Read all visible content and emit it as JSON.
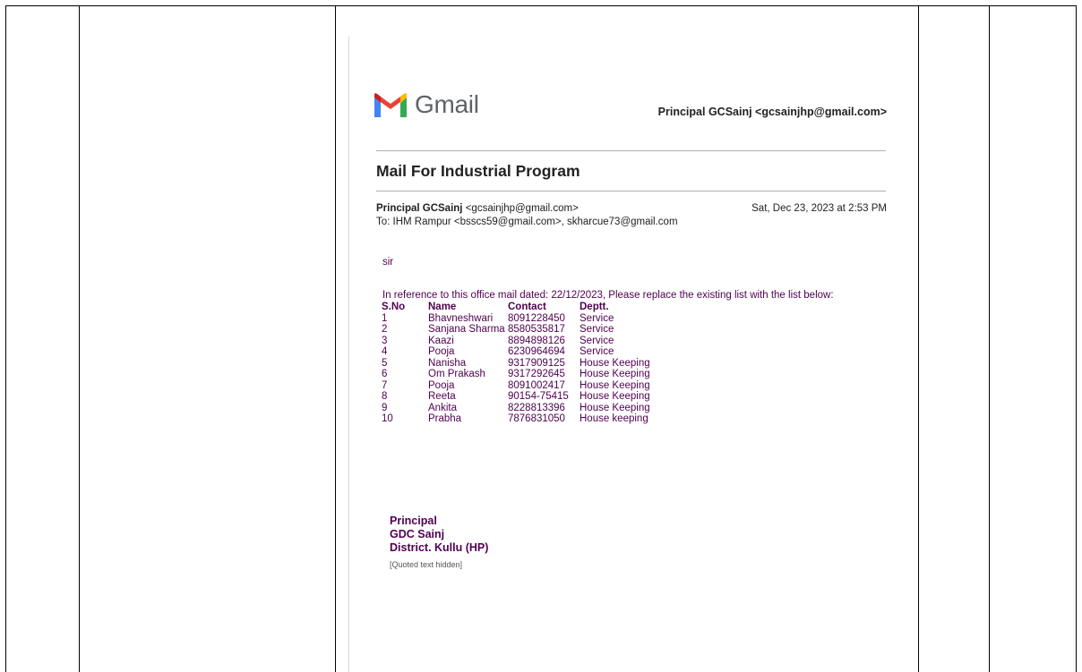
{
  "gmail": {
    "logo_text": "Gmail",
    "account": "Principal GCSainj <gcsainjhp@gmail.com>"
  },
  "email": {
    "subject": "Mail For Industrial Program",
    "sender_name": "Principal GCSainj",
    "sender_email": "<gcsainjhp@gmail.com>",
    "date": "Sat, Dec 23, 2023 at 2:53 PM",
    "to": "To: IHM Rampur <bsscs59@gmail.com>, skharcue73@gmail.com",
    "greeting": "sir",
    "reference": "In reference to this office mail dated: 22/12/2023, Please replace the existing list with the list below:",
    "table": {
      "headers": [
        "S.No",
        "Name",
        "Contact",
        "Deptt."
      ],
      "rows": [
        [
          "1",
          "Bhavneshwari",
          "8091228450",
          "Service"
        ],
        [
          "2",
          "Sanjana Sharma",
          "8580535817",
          "Service"
        ],
        [
          "3",
          "Kaazi",
          "8894898126",
          "Service"
        ],
        [
          "4",
          "Pooja",
          "6230964694",
          "Service"
        ],
        [
          "5",
          "Nanisha",
          "9317909125",
          "House Keeping"
        ],
        [
          "6",
          "Om Prakash",
          "9317292645",
          "House Keeping"
        ],
        [
          "7",
          "Pooja",
          "8091002417",
          "House Keeping"
        ],
        [
          "8",
          "Reeta",
          "90154-75415",
          "House Keeping"
        ],
        [
          "9",
          "Ankita",
          "8228813396",
          "House Keeping"
        ],
        [
          "10",
          "Prabha",
          "7876831050",
          "House keeping"
        ]
      ]
    },
    "signature": [
      "Principal",
      "GDC Sainj",
      "District. Kullu (HP)"
    ],
    "quoted_note": "[Quoted text hidden]"
  },
  "colors": {
    "body_text": "#500050",
    "logo_red": "#EA4335",
    "logo_blue": "#4285F4",
    "logo_green": "#34A853",
    "logo_yellow": "#FBBC04",
    "logo_darkred": "#C5221F"
  }
}
